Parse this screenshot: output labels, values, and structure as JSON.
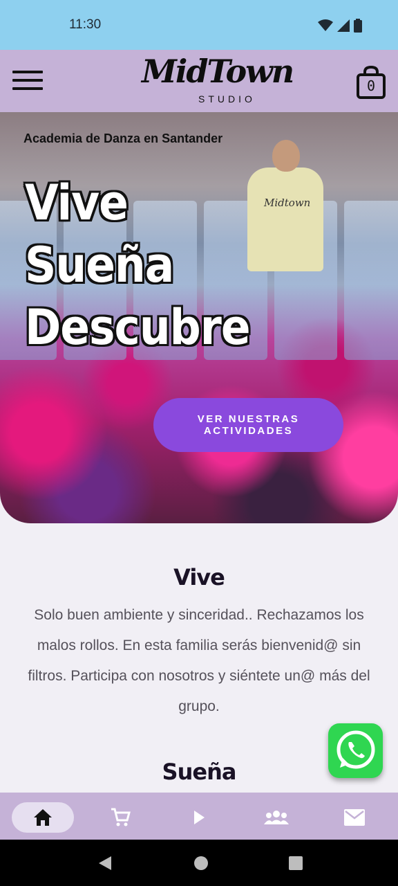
{
  "status_bar": {
    "time": "11:30",
    "icons": [
      "wifi-icon",
      "signal-icon",
      "battery-icon"
    ]
  },
  "header": {
    "logo_script": "MidTown",
    "logo_studio": "STUDIO",
    "cart_count": "0"
  },
  "hero": {
    "tagline": "Academia de Danza en Santander",
    "words": [
      "Vive",
      "Sueña",
      "Descubre"
    ],
    "cta_label": "VER NUESTRAS ACTIVIDADES",
    "shirt_logo": "Midtown"
  },
  "sections": [
    {
      "title": "Vive",
      "text": "Solo buen ambiente y  sinceridad.. Rechazamos los malos rollos.  En esta familia serás bienvenid@ sin filtros. Participa con nosotros y siéntete un@ más del grupo."
    },
    {
      "title": "Sueña"
    }
  ],
  "bottom_nav": {
    "items": [
      "home-icon",
      "cart-icon",
      "play-icon",
      "group-icon",
      "mail-icon"
    ],
    "active": "home-icon"
  },
  "colors": {
    "status_bar": "#8ed0ef",
    "header": "#c5b2d7",
    "accent": "#8a49dd",
    "whatsapp": "#2fd651",
    "background": "#f1eff5"
  }
}
